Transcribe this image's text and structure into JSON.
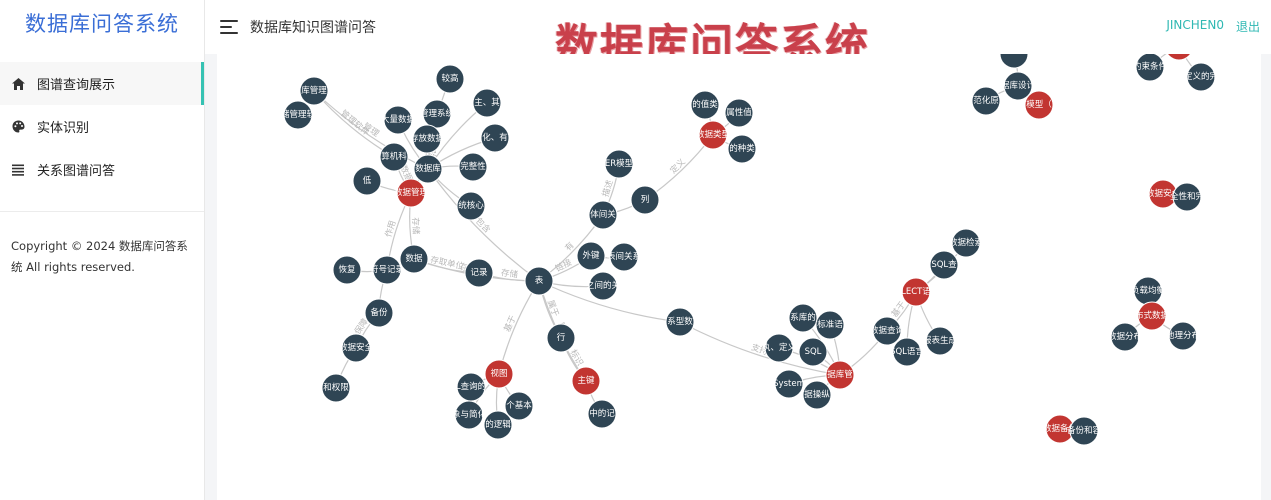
{
  "app": {
    "title": "数据库问答系统"
  },
  "sidebar": {
    "items": [
      {
        "label": "图谱查询展示",
        "icon": "home-icon",
        "active": true
      },
      {
        "label": "实体识别",
        "icon": "palette-icon",
        "active": false
      },
      {
        "label": "关系图谱问答",
        "icon": "list-icon",
        "active": false
      }
    ],
    "copyright": "Copyright © 2024 数据库问答系统 All rights reserved."
  },
  "header": {
    "breadcrumb": "数据库知识图谱问答",
    "banner": "数据库问答系统",
    "username": "JINCHEN0",
    "logout": "退出"
  },
  "colors": {
    "entity": "#2f4554",
    "highlight": "#c23531",
    "accent": "#2fb8b3",
    "brand": "#3a6ed6"
  },
  "graph": {
    "nodes": [
      {
        "id": "n1",
        "label": "较高",
        "type": "entity"
      },
      {
        "id": "n2",
        "label": "主、其",
        "type": "entity"
      },
      {
        "id": "n3",
        "label": "库管理",
        "type": "entity"
      },
      {
        "id": "n4",
        "label": "管理系统",
        "type": "entity"
      },
      {
        "id": "n5",
        "label": "大量数据",
        "type": "entity"
      },
      {
        "id": "n6",
        "label": "化、有",
        "type": "entity"
      },
      {
        "id": "n7",
        "label": "储管理软",
        "type": "entity"
      },
      {
        "id": "n8",
        "label": "存放数据",
        "type": "entity"
      },
      {
        "id": "n9",
        "label": "算机科",
        "type": "entity"
      },
      {
        "id": "n10",
        "label": "数据库",
        "type": "entity"
      },
      {
        "id": "n11",
        "label": "完整性",
        "type": "entity"
      },
      {
        "id": "n12",
        "label": "低",
        "type": "entity"
      },
      {
        "id": "n13",
        "label": "数据管理",
        "type": "highlight"
      },
      {
        "id": "n14",
        "label": "统核心",
        "type": "entity"
      },
      {
        "id": "n15",
        "label": "ER模型",
        "type": "entity"
      },
      {
        "id": "n16",
        "label": "的值类",
        "type": "entity"
      },
      {
        "id": "n17",
        "label": "属性值",
        "type": "entity"
      },
      {
        "id": "n18",
        "label": "数据类型",
        "type": "highlight"
      },
      {
        "id": "n19",
        "label": "的种类",
        "type": "entity"
      },
      {
        "id": "n20",
        "label": "列",
        "type": "entity"
      },
      {
        "id": "n21",
        "label": "体间关",
        "type": "entity"
      },
      {
        "id": "n22",
        "label": "恢复",
        "type": "entity"
      },
      {
        "id": "n23",
        "label": "符号记录",
        "type": "entity"
      },
      {
        "id": "n24",
        "label": "数据",
        "type": "entity"
      },
      {
        "id": "n25",
        "label": "记录",
        "type": "entity"
      },
      {
        "id": "n26",
        "label": "表",
        "type": "entity"
      },
      {
        "id": "n27",
        "label": "外键",
        "type": "entity"
      },
      {
        "id": "n28",
        "label": "表间关系",
        "type": "entity"
      },
      {
        "id": "n29",
        "label": "之间的关",
        "type": "entity"
      },
      {
        "id": "n30",
        "label": "备份",
        "type": "entity"
      },
      {
        "id": "n31",
        "label": "数据安全",
        "type": "entity"
      },
      {
        "id": "n32",
        "label": "和权限",
        "type": "entity"
      },
      {
        "id": "n33",
        "label": "行",
        "type": "entity"
      },
      {
        "id": "n34",
        "label": "视图",
        "type": "highlight"
      },
      {
        "id": "n35",
        "label": "L查询的",
        "type": "entity"
      },
      {
        "id": "n36",
        "label": "象与简化",
        "type": "entity"
      },
      {
        "id": "n37",
        "label": "的逻辑",
        "type": "entity"
      },
      {
        "id": "n38",
        "label": "个基本",
        "type": "entity"
      },
      {
        "id": "n39",
        "label": "主键",
        "type": "highlight"
      },
      {
        "id": "n40",
        "label": "中的记",
        "type": "entity"
      },
      {
        "id": "n41",
        "label": "系型数",
        "type": "entity"
      },
      {
        "id": "n42",
        "label": "系库的",
        "type": "entity"
      },
      {
        "id": "n43",
        "label": "标准语",
        "type": "entity"
      },
      {
        "id": "n44",
        "label": "数据查询",
        "type": "entity"
      },
      {
        "id": "n45",
        "label": "SQL查",
        "type": "entity"
      },
      {
        "id": "n46",
        "label": "数据检索",
        "type": "entity"
      },
      {
        "id": "n47",
        "label": "LECT语",
        "type": "highlight"
      },
      {
        "id": "n48",
        "label": "报表生成",
        "type": "entity"
      },
      {
        "id": "n49",
        "label": "SQL语言",
        "type": "entity"
      },
      {
        "id": "n50",
        "label": "执、定义",
        "type": "entity"
      },
      {
        "id": "n51",
        "label": "SQL",
        "type": "entity"
      },
      {
        "id": "n52",
        "label": "据库管",
        "type": "highlight"
      },
      {
        "id": "n53",
        "label": "System",
        "type": "entity"
      },
      {
        "id": "n54",
        "label": "据操纵",
        "type": "entity"
      },
      {
        "id": "n55",
        "label": "",
        "type": "entity"
      },
      {
        "id": "n56",
        "label": "据库设计",
        "type": "entity"
      },
      {
        "id": "n57",
        "label": "范化原",
        "type": "entity"
      },
      {
        "id": "n58",
        "label": "模型（",
        "type": "highlight"
      },
      {
        "id": "n59",
        "label": "约束条件",
        "type": "entity"
      },
      {
        "id": "n60",
        "label": "",
        "type": "highlight"
      },
      {
        "id": "n61",
        "label": "定义的完",
        "type": "entity"
      },
      {
        "id": "n62",
        "label": "数据安全",
        "type": "highlight"
      },
      {
        "id": "n63",
        "label": "全性和完",
        "type": "entity"
      },
      {
        "id": "n64",
        "label": "负载均衡",
        "type": "entity"
      },
      {
        "id": "n65",
        "label": "布式数据",
        "type": "highlight"
      },
      {
        "id": "n66",
        "label": "数据分布",
        "type": "entity"
      },
      {
        "id": "n67",
        "label": "地理分布",
        "type": "entity"
      },
      {
        "id": "n68",
        "label": "数据备份",
        "type": "highlight"
      },
      {
        "id": "n69",
        "label": "备份和容",
        "type": "entity"
      }
    ],
    "edges": [
      {
        "source": "n3",
        "target": "n7",
        "label": ""
      },
      {
        "source": "n3",
        "target": "n10",
        "label": "管理"
      },
      {
        "source": "n3",
        "target": "n9",
        "label": "管理软件"
      },
      {
        "source": "n4",
        "target": "n10",
        "label": ""
      },
      {
        "source": "n5",
        "target": "n10",
        "label": ""
      },
      {
        "source": "n1",
        "target": "n10",
        "label": ""
      },
      {
        "source": "n2",
        "target": "n10",
        "label": ""
      },
      {
        "source": "n6",
        "target": "n10",
        "label": ""
      },
      {
        "source": "n8",
        "target": "n10",
        "label": "数据结构"
      },
      {
        "source": "n11",
        "target": "n10",
        "label": ""
      },
      {
        "source": "n12",
        "target": "n13",
        "label": ""
      },
      {
        "source": "n9",
        "target": "n13",
        "label": "数据"
      },
      {
        "source": "n10",
        "target": "n13",
        "label": ""
      },
      {
        "source": "n10",
        "target": "n14",
        "label": ""
      },
      {
        "source": "n10",
        "target": "n26",
        "label": "包含"
      },
      {
        "source": "n13",
        "target": "n24",
        "label": "存储"
      },
      {
        "source": "n13",
        "target": "n23",
        "label": "作用"
      },
      {
        "source": "n24",
        "target": "n25",
        "label": "存取单位"
      },
      {
        "source": "n24",
        "target": "n26",
        "label": "存取单位"
      },
      {
        "source": "n25",
        "target": "n26",
        "label": "存储"
      },
      {
        "source": "n22",
        "target": "n23",
        "label": ""
      },
      {
        "source": "n23",
        "target": "n30",
        "label": ""
      },
      {
        "source": "n30",
        "target": "n31",
        "label": "保障"
      },
      {
        "source": "n31",
        "target": "n32",
        "label": ""
      },
      {
        "source": "n26",
        "target": "n21",
        "label": "有"
      },
      {
        "source": "n21",
        "target": "n15",
        "label": "描述"
      },
      {
        "source": "n21",
        "target": "n20",
        "label": ""
      },
      {
        "source": "n20",
        "target": "n18",
        "label": "定义"
      },
      {
        "source": "n18",
        "target": "n16",
        "label": ""
      },
      {
        "source": "n18",
        "target": "n17",
        "label": ""
      },
      {
        "source": "n18",
        "target": "n19",
        "label": ""
      },
      {
        "source": "n26",
        "target": "n27",
        "label": "链接"
      },
      {
        "source": "n27",
        "target": "n28",
        "label": ""
      },
      {
        "source": "n26",
        "target": "n29",
        "label": ""
      },
      {
        "source": "n26",
        "target": "n33",
        "label": "属于"
      },
      {
        "source": "n26",
        "target": "n34",
        "label": "基于"
      },
      {
        "source": "n34",
        "target": "n35",
        "label": ""
      },
      {
        "source": "n34",
        "target": "n36",
        "label": ""
      },
      {
        "source": "n34",
        "target": "n37",
        "label": ""
      },
      {
        "source": "n34",
        "target": "n38",
        "label": ""
      },
      {
        "source": "n33",
        "target": "n39",
        "label": "标识"
      },
      {
        "source": "n26",
        "target": "n39",
        "label": "属于"
      },
      {
        "source": "n39",
        "target": "n40",
        "label": ""
      },
      {
        "source": "n26",
        "target": "n41",
        "label": ""
      },
      {
        "source": "n41",
        "target": "n52",
        "label": "支持"
      },
      {
        "source": "n52",
        "target": "n42",
        "label": ""
      },
      {
        "source": "n52",
        "target": "n43",
        "label": ""
      },
      {
        "source": "n52",
        "target": "n50",
        "label": ""
      },
      {
        "source": "n52",
        "target": "n51",
        "label": ""
      },
      {
        "source": "n52",
        "target": "n53",
        "label": ""
      },
      {
        "source": "n52",
        "target": "n54",
        "label": ""
      },
      {
        "source": "n52",
        "target": "n44",
        "label": ""
      },
      {
        "source": "n44",
        "target": "n47",
        "label": "基于"
      },
      {
        "source": "n47",
        "target": "n45",
        "label": ""
      },
      {
        "source": "n47",
        "target": "n46",
        "label": ""
      },
      {
        "source": "n47",
        "target": "n48",
        "label": ""
      },
      {
        "source": "n47",
        "target": "n49",
        "label": ""
      },
      {
        "source": "n56",
        "target": "n55",
        "label": ""
      },
      {
        "source": "n56",
        "target": "n57",
        "label": ""
      },
      {
        "source": "n56",
        "target": "n58",
        "label": ""
      },
      {
        "source": "n60",
        "target": "n59",
        "label": ""
      },
      {
        "source": "n60",
        "target": "n61",
        "label": ""
      },
      {
        "source": "n62",
        "target": "n63",
        "label": ""
      },
      {
        "source": "n65",
        "target": "n64",
        "label": ""
      },
      {
        "source": "n65",
        "target": "n66",
        "label": ""
      },
      {
        "source": "n65",
        "target": "n67",
        "label": ""
      },
      {
        "source": "n68",
        "target": "n69",
        "label": ""
      }
    ]
  }
}
